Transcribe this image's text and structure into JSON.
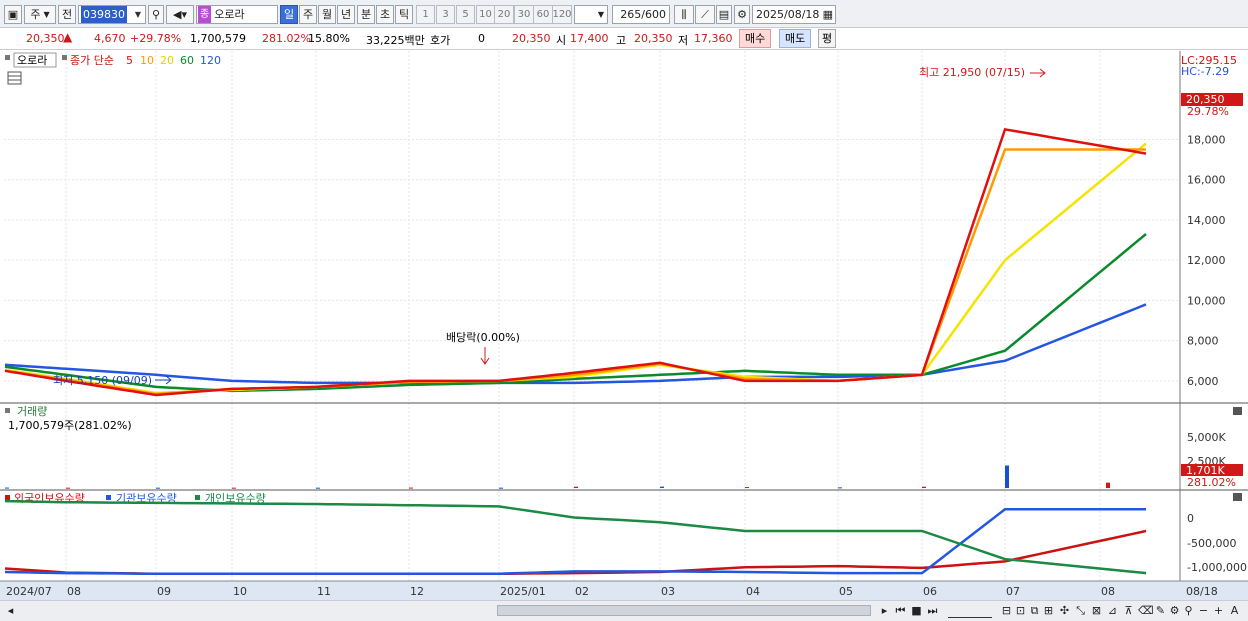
{
  "toolbar": {
    "market": "주",
    "prev_label": "전",
    "stock_code": "039830",
    "stock_badge": "종",
    "stock_name": "오로라",
    "periods": [
      "일",
      "주",
      "월",
      "년",
      "분",
      "초",
      "틱"
    ],
    "selected_period": "일",
    "intervals": [
      "1",
      "3",
      "5",
      "10",
      "20",
      "30",
      "60",
      "120"
    ],
    "count": "265",
    "count_max": "/600",
    "date": "2025/08/18"
  },
  "info": {
    "price": "20,350",
    "change": "4,670",
    "change_pct": "+29.78%",
    "volume": "1,700,579",
    "volume_ratio": "281.02%",
    "turnover": "15.80%",
    "amount": "33,225백만",
    "quote_label": "호가",
    "quote_value": "0",
    "quote_price": "20,350",
    "open_label": "시",
    "open": "17,400",
    "high_label": "고",
    "high": "20,350",
    "low_label": "저",
    "low": "17,360",
    "buy": "매수",
    "sell": "매도",
    "eq": "평"
  },
  "price_panel": {
    "title": "오로라",
    "ma_label": "종가 단순",
    "ma_periods": [
      "5",
      "10",
      "20",
      "60",
      "120"
    ],
    "ma_colors": [
      "#e01010",
      "#ff9a00",
      "#f5e300",
      "#0b8a2c",
      "#2456e0"
    ],
    "lc": "LC:295.15",
    "hc": "HC:-7.29",
    "high_annotation": "최고 21,950 (07/15)",
    "low_annotation": "최저 5,150 (09/09)",
    "dividend_annotation": "배당락(0.00%)",
    "price_tag": "20,350",
    "pct_tag": "29.78%",
    "y_ticks": [
      6000,
      8000,
      10000,
      12000,
      14000,
      16000,
      18000
    ],
    "y_tick_labels": [
      "6,000",
      "8,000",
      "10,000",
      "12,000",
      "14,000",
      "16,000",
      "18,000"
    ]
  },
  "volume_panel": {
    "title": "거래량",
    "value": "1,700,579주(281.02%)",
    "y_tick_labels": [
      "5,000K",
      "2,500K"
    ],
    "vol_tag": "1,701K",
    "vol_pct_tag": "281.02%"
  },
  "holdings_panel": {
    "series_labels": [
      "외국인보유수량",
      "기관보유수량",
      "개인보유수량"
    ],
    "series_colors": [
      "#cc1111",
      "#2456e0",
      "#1a8a44"
    ],
    "y_tick_labels": [
      "0",
      "-500,000",
      "-1,000,000"
    ]
  },
  "x_axis": {
    "labels": [
      "2024/07",
      "08",
      "09",
      "10",
      "11",
      "12",
      "2025/01",
      "02",
      "03",
      "04",
      "05",
      "06",
      "07",
      "08"
    ],
    "last_label": "08/18"
  },
  "chart_data": [
    {
      "type": "line",
      "title": "오로라",
      "x": [
        "2024/07",
        "2024/08",
        "2024/09",
        "2024/10",
        "2024/11",
        "2024/12",
        "2025/01",
        "2025/02",
        "2025/03",
        "2025/04",
        "2025/05",
        "2025/06",
        "2025/07",
        "2025/08"
      ],
      "series": [
        {
          "name": "5",
          "values": [
            6500,
            6000,
            5300,
            5600,
            5700,
            6000,
            6000,
            6400,
            6900,
            6000,
            6000,
            6300,
            18500,
            17300
          ]
        },
        {
          "name": "10",
          "values": [
            6500,
            6050,
            5350,
            5600,
            5700,
            5950,
            6000,
            6300,
            6850,
            6100,
            6000,
            6300,
            17500,
            17500
          ]
        },
        {
          "name": "20",
          "values": [
            6550,
            6100,
            5400,
            5550,
            5700,
            5950,
            6000,
            6200,
            6800,
            6200,
            6000,
            6300,
            12000,
            17800
          ]
        },
        {
          "name": "60",
          "values": [
            6700,
            6300,
            5700,
            5500,
            5600,
            5800,
            5900,
            6100,
            6300,
            6500,
            6300,
            6300,
            7500,
            13300
          ]
        },
        {
          "name": "120",
          "values": [
            6800,
            6600,
            6300,
            6000,
            5900,
            5900,
            5900,
            5900,
            6000,
            6200,
            6200,
            6300,
            7000,
            9800
          ]
        }
      ],
      "ylim": [
        5000,
        22000
      ]
    },
    {
      "type": "bar",
      "title": "거래량",
      "x": [
        "2024/07",
        "2024/08",
        "2024/09",
        "2024/10",
        "2024/11",
        "2024/12",
        "2025/01",
        "2025/02",
        "2025/03",
        "2025/04",
        "2025/05",
        "2025/06",
        "2025/07",
        "2025/08"
      ],
      "series": [
        {
          "name": "거래량",
          "values": [
            40,
            30,
            30,
            30,
            30,
            40,
            30,
            120,
            130,
            90,
            60,
            120,
            2100,
            500
          ]
        }
      ],
      "unit": "K",
      "ylim": [
        0,
        7000
      ]
    },
    {
      "type": "line",
      "x": [
        "2024/07",
        "2024/08",
        "2024/09",
        "2024/10",
        "2024/11",
        "2024/12",
        "2025/01",
        "2025/02",
        "2025/03",
        "2025/04",
        "2025/05",
        "2025/06",
        "2025/07",
        "2025/08"
      ],
      "series": [
        {
          "name": "외국인보유수량",
          "values": [
            -1020000,
            -1090000,
            -1110000,
            -1110000,
            -1110000,
            -1110000,
            -1110000,
            -1100000,
            -1080000,
            -1000000,
            -980000,
            -1010000,
            -900000,
            -380000
          ]
        },
        {
          "name": "기관보유수량",
          "values": [
            -1080000,
            -1100000,
            -1110000,
            -1110000,
            -1110000,
            -1110000,
            -1110000,
            -1070000,
            -1070000,
            -1080000,
            -1100000,
            -1100000,
            -10000,
            -10000
          ]
        },
        {
          "name": "개인보유수량",
          "values": [
            130000,
            110000,
            100000,
            90000,
            80000,
            60000,
            40000,
            -150000,
            -230000,
            -380000,
            -380000,
            -380000,
            -860000,
            -1100000
          ]
        }
      ],
      "ylim": [
        -1200000,
        200000
      ]
    }
  ]
}
